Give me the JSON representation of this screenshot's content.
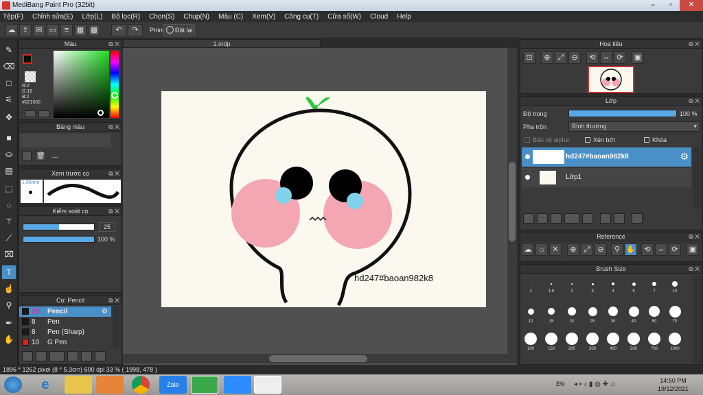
{
  "window": {
    "title": "MediBang Paint Pro (32bit)"
  },
  "menu": [
    "Tệp(F)",
    "Chỉnh sửa(E)",
    "Lớp(L)",
    "Bộ lọc(R)",
    "Chọn(S)",
    "Chụp(N)",
    "Màu (C)",
    "Xem(V)",
    "Công cụ(T)",
    "Cửa sổ(W)",
    "Cloud",
    "Help"
  ],
  "toolbar": {
    "key_label": "Phím",
    "reset_label": "Đặt lại"
  },
  "color_panel": {
    "title": "Màu",
    "r": "R:2",
    "g": "G:16",
    "b": "B:2",
    "hex": "#021002"
  },
  "palette_panel": {
    "title": "Bảng màu",
    "value": "---"
  },
  "brush_preview": {
    "title": "Xem trước cọ",
    "size": "1.06mm"
  },
  "brush_control": {
    "title": "Kiểm soát cọ",
    "size_value": "25",
    "opacity_value": "100 %"
  },
  "brush_list": {
    "title": "Cọ: Pencil",
    "items": [
      {
        "size": "25",
        "name": "Pencil",
        "color": "#1a1a1a",
        "selected": true
      },
      {
        "size": "8",
        "name": "Pen",
        "color": "#1a1a1a"
      },
      {
        "size": "8",
        "name": "Pen (Sharp)",
        "color": "#1a1a1a"
      },
      {
        "size": "10",
        "name": "G Pen",
        "color": "#e02020"
      }
    ]
  },
  "document": {
    "tab": "1.mdp",
    "canvas_text": "hd247#baoan982k8"
  },
  "navigator": {
    "title": "Hoa tiêu"
  },
  "layer_panel": {
    "title": "Lớp",
    "opacity_label": "Độ trong",
    "opacity_value": "100 %",
    "opacity": 1.0,
    "blend_label": "Pha trộn",
    "blend_value": "Bình thường",
    "protect_alpha": "Bảo vệ alpha",
    "clip": "Xén bớt",
    "lock": "Khóa",
    "layers": [
      {
        "name": "hd247#baoan982k8",
        "selected": true
      },
      {
        "name": "Lớp1",
        "selected": false
      }
    ]
  },
  "reference_panel": {
    "title": "Reference"
  },
  "brush_size_panel": {
    "title": "Brush Size",
    "sizes": [
      "1",
      "1.5",
      "2",
      "3",
      "4",
      "5",
      "7",
      "10",
      "12",
      "15",
      "20",
      "25",
      "30",
      "40",
      "50",
      "70",
      "100",
      "150",
      "200",
      "300",
      "400",
      "500",
      "700",
      "1000"
    ]
  },
  "status": {
    "text": "1896 * 1262 pixel   (8 * 5.3cm)   600 dpi   33 %   ( 1998, 478 )"
  },
  "taskbar": {
    "lang": "EN",
    "time": "14:50 PM",
    "date": "19/12/2021",
    "zalo": "Zalo"
  }
}
